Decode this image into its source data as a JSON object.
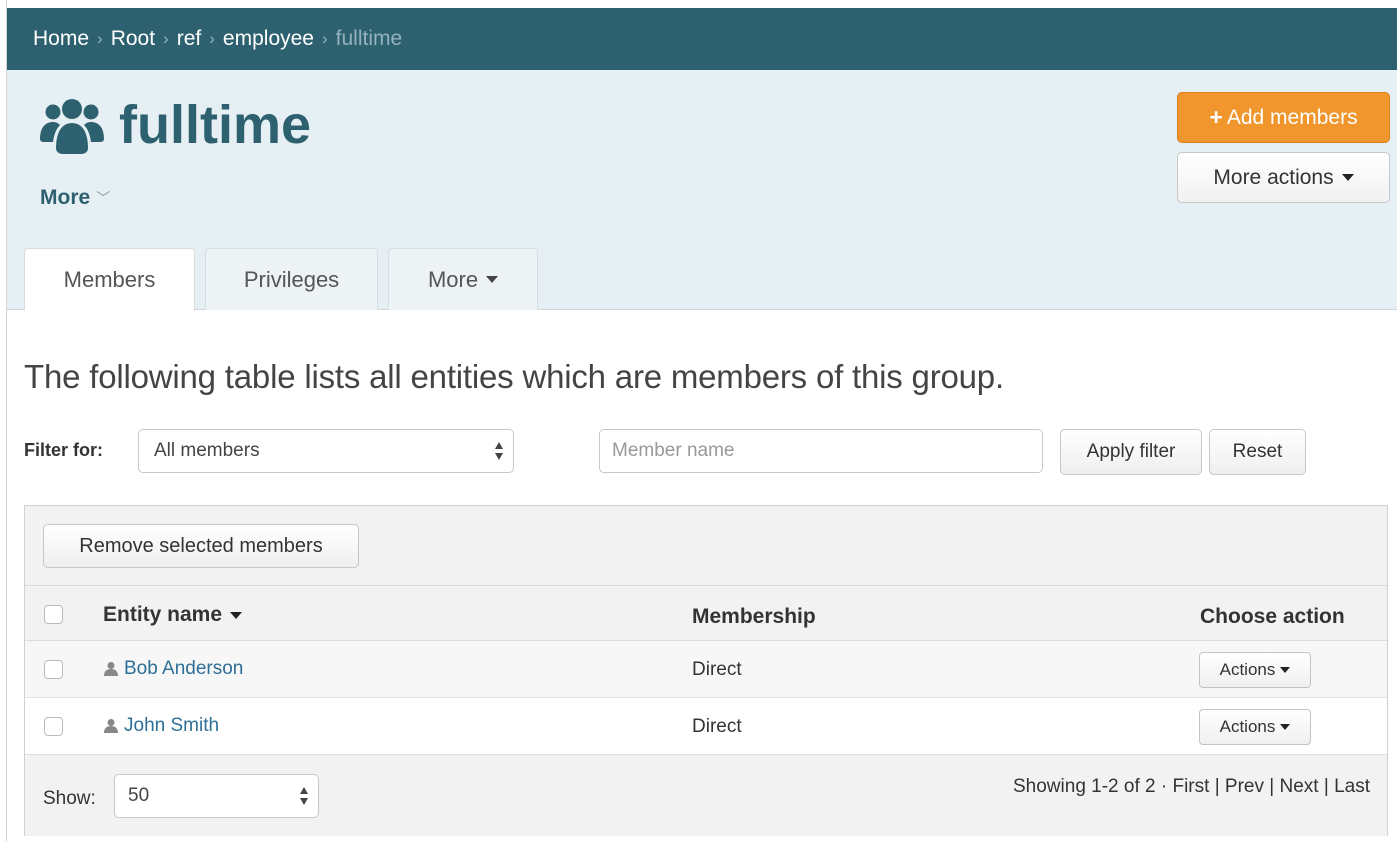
{
  "breadcrumb": {
    "items": [
      "Home",
      "Root",
      "ref",
      "employee"
    ],
    "current": "fulltime",
    "separator": "›"
  },
  "header": {
    "title": "fulltime",
    "title_icon": "users-group-icon",
    "more_label": "More",
    "add_members_label": "Add members",
    "more_actions_label": "More actions"
  },
  "tabs": {
    "members": "Members",
    "privileges": "Privileges",
    "more": "More"
  },
  "intro_text": "The following table lists all entities which are members of this group.",
  "filter": {
    "label": "Filter for:",
    "selected": "All members",
    "placeholder": "Member name",
    "apply_label": "Apply filter",
    "reset_label": "Reset"
  },
  "table": {
    "remove_label": "Remove selected members",
    "columns": {
      "name": "Entity name",
      "membership": "Membership",
      "action": "Choose action"
    },
    "rows": [
      {
        "name": "Bob Anderson",
        "membership": "Direct",
        "action": "Actions"
      },
      {
        "name": "John Smith",
        "membership": "Direct",
        "action": "Actions"
      }
    ]
  },
  "footer": {
    "show_label": "Show:",
    "show_value": "50",
    "summary": "Showing 1-2 of 2 ·",
    "first": "First",
    "prev": "Prev",
    "next": "Next",
    "last": "Last",
    "divider": "|"
  },
  "colors": {
    "primary": "#2e6170",
    "accent_orange": "#f0962d",
    "link": "#2e6f98"
  }
}
